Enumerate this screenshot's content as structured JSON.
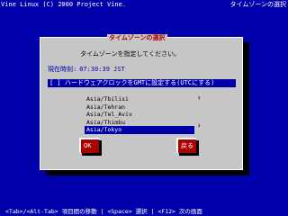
{
  "header": {
    "left_text": "Vine Linux (C) 2000 Project Vine.",
    "right_text": "タイムゾーンの選択"
  },
  "dialog": {
    "title": "タイムゾーンの選択",
    "prompt": "タイムゾーンを指定してください。",
    "current_time_label": "現在時刻:",
    "current_time_value": "07:30:39 JST",
    "utc_checkbox": "[ ] ハードウェアクロックをGMTに設定する(UTCにする)",
    "timezones": [
      {
        "label": "Asia/Tbilisi",
        "selected": false
      },
      {
        "label": "Asia/Tehran",
        "selected": false
      },
      {
        "label": "Asia/Tel_Aviv",
        "selected": false
      },
      {
        "label": "Asia/Thimbu",
        "selected": false
      },
      {
        "label": "Asia/Tokyo",
        "selected": true
      }
    ],
    "scroll_up": "↑",
    "scroll_down": "↓",
    "ok_label": "OK",
    "back_label": "戻る"
  },
  "footer": {
    "hint": "<Tab>/<Alt-Tab> 項目間の移動 | <Space> 選択 | <F12> 次の画面"
  },
  "colors": {
    "background": "#0000aa",
    "dialog": "#c6c6c6",
    "accent": "#aa0000"
  }
}
